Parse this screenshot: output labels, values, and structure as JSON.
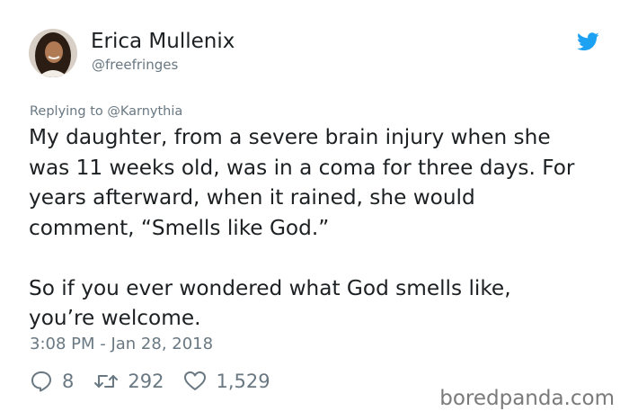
{
  "tweet": {
    "author": {
      "display_name": "Erica Mullenix",
      "handle": "@freefringes"
    },
    "replying_to": "Replying to @Karnythia",
    "body": {
      "paragraph1": [
        "My daughter, from a severe brain injury when she",
        "was 11 weeks old, was in a coma for three days. For",
        "years afterward, when it rained, she would",
        "comment, “Smells like God.”"
      ],
      "paragraph2": [
        "So if you ever wondered what God smells like,",
        "you’re welcome."
      ]
    },
    "timestamp": "3:08 PM - Jan 28, 2018",
    "actions": {
      "replies": "8",
      "retweets": "292",
      "likes": "1,529"
    }
  },
  "watermark": "boredpanda.com",
  "colors": {
    "text": "#1c2022",
    "muted": "#697882",
    "twitter_blue": "#1da1f2"
  },
  "icons": {
    "brand": "twitter-bird-icon",
    "reply": "reply-icon",
    "retweet": "retweet-icon",
    "like": "heart-icon"
  }
}
